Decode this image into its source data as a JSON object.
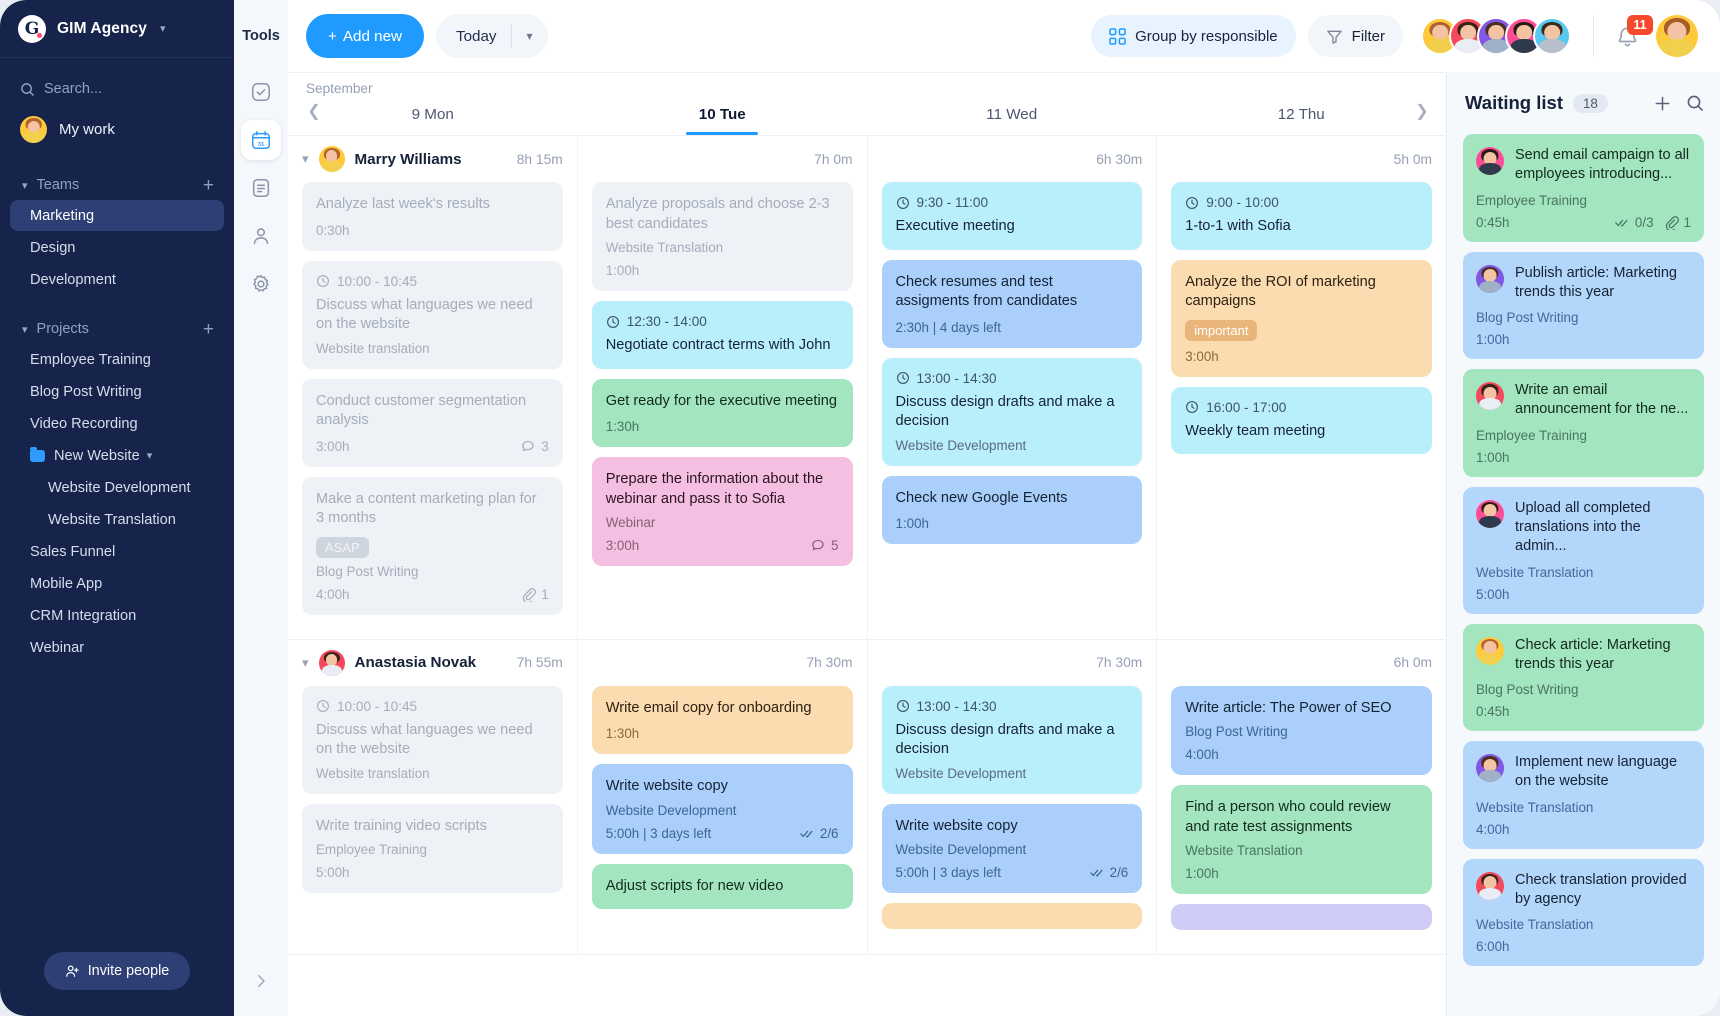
{
  "sidebar": {
    "brand": {
      "name": "GIM Agency",
      "logo_letter": "G",
      "chevron": "⌄"
    },
    "search_placeholder": "Search...",
    "my_work_label": "My work",
    "teams": {
      "title": "Teams",
      "add_label": "+",
      "items": [
        {
          "label": "Marketing",
          "active": true
        },
        {
          "label": "Design",
          "active": false
        },
        {
          "label": "Development",
          "active": false
        }
      ]
    },
    "projects": {
      "title": "Projects",
      "add_label": "+",
      "items": [
        {
          "label": "Employee Training",
          "type": "item"
        },
        {
          "label": "Blog Post Writing",
          "type": "item"
        },
        {
          "label": "Video Recording",
          "type": "item"
        },
        {
          "label": "New Website",
          "type": "folder"
        },
        {
          "label": "Website Development",
          "type": "sub"
        },
        {
          "label": "Website Translation",
          "type": "sub"
        },
        {
          "label": "Sales Funnel",
          "type": "item"
        },
        {
          "label": "Mobile App",
          "type": "item"
        },
        {
          "label": "CRM Integration",
          "type": "item"
        },
        {
          "label": "Webinar",
          "type": "item"
        }
      ]
    },
    "invite_label": "Invite people"
  },
  "rail": {
    "title": "Tools",
    "items": [
      {
        "icon": "checkbox-icon",
        "selected": false
      },
      {
        "icon": "calendar-icon",
        "selected": true
      },
      {
        "icon": "notes-icon",
        "selected": false
      },
      {
        "icon": "person-icon",
        "selected": false
      },
      {
        "icon": "gear-icon",
        "selected": false
      }
    ],
    "expand_icon": "chevron-right-icon"
  },
  "topbar": {
    "add_new_label": "Add new",
    "today_label": "Today",
    "group_by_label": "Group by responsible",
    "filter_label": "Filter",
    "notification_count": "11",
    "accent_color": "#1f9bff",
    "badge_color": "#f4492d"
  },
  "calendar": {
    "month": "September",
    "days": [
      {
        "label": "9 Mon",
        "today": false
      },
      {
        "label": "10 Tue",
        "today": true
      },
      {
        "label": "11 Wed",
        "today": false
      },
      {
        "label": "12 Thu",
        "today": false
      }
    ],
    "rows": [
      {
        "person": "Marry Williams",
        "totals": [
          "8h 15m",
          "7h 0m",
          "6h 30m",
          "5h 0m"
        ],
        "columns": [
          [
            {
              "color": "grey",
              "title": "Analyze last week's results",
              "duration": "0:30h"
            },
            {
              "color": "grey",
              "time": "10:00 - 10:45",
              "title": "Discuss what languages we need on the website",
              "project": "Website translation"
            },
            {
              "color": "grey",
              "title": "Conduct customer segmentation analysis",
              "duration": "3:00h",
              "comments": "3"
            },
            {
              "color": "grey",
              "title": "Make a content marketing plan for 3 months",
              "tag": "ASAP",
              "project": "Blog Post Writing",
              "duration": "4:00h",
              "attachments": "1"
            }
          ],
          [
            {
              "color": "grey",
              "title": "Analyze proposals and choose 2-3 best candidates",
              "project": "Website Translation",
              "duration": "1:00h"
            },
            {
              "color": "cyan",
              "time": "12:30 - 14:00",
              "title": "Negotiate contract terms with John"
            },
            {
              "color": "green",
              "title": "Get ready for the executive meeting",
              "duration": "1:30h"
            },
            {
              "color": "pink",
              "title": "Prepare the information about the webinar and pass it to Sofia",
              "project": "Webinar",
              "duration": "3:00h",
              "comments": "5"
            }
          ],
          [
            {
              "color": "cyan",
              "time": "9:30 - 11:00",
              "title": "Executive meeting"
            },
            {
              "color": "blue",
              "title": "Check resumes and test assigments from candidates",
              "meta": "2:30h | 4 days left"
            },
            {
              "color": "cyan",
              "time": "13:00 - 14:30",
              "title": "Discuss design drafts and make a decision",
              "project": "Website Development"
            },
            {
              "color": "blue",
              "title": "Check new Google Events",
              "duration": "1:00h"
            }
          ],
          [
            {
              "color": "cyan",
              "time": "9:00 - 10:00",
              "title": "1-to-1 with Sofia"
            },
            {
              "color": "orange",
              "title": "Analyze the ROI of marketing campaigns",
              "tag": "important",
              "duration": "3:00h"
            },
            {
              "color": "cyan",
              "time": "16:00 - 17:00",
              "title": "Weekly team meeting"
            }
          ]
        ]
      },
      {
        "person": "Anastasia Novak",
        "totals": [
          "7h 55m",
          "7h 30m",
          "7h 30m",
          "6h 0m"
        ],
        "columns": [
          [
            {
              "color": "grey",
              "time": "10:00 - 10:45",
              "title": "Discuss what languages we need on the website",
              "project": "Website translation"
            },
            {
              "color": "grey",
              "title": "Write training video scripts",
              "project": "Employee Training",
              "duration": "5:00h"
            }
          ],
          [
            {
              "color": "orange",
              "title": "Write email copy for onboarding",
              "duration": "1:30h"
            },
            {
              "color": "blue",
              "title": "Write website copy",
              "project": "Website Development",
              "meta": "5:00h | 3 days left",
              "checks": "2/6"
            },
            {
              "color": "green",
              "title": "Adjust scripts for new video"
            }
          ],
          [
            {
              "color": "cyan",
              "time": "13:00 - 14:30",
              "title": "Discuss design drafts and make a decision",
              "project": "Website Development"
            },
            {
              "color": "blue",
              "title": "Write website copy",
              "project": "Website Development",
              "meta": "5:00h | 3 days left",
              "checks": "2/6"
            },
            {
              "color": "orange",
              "title": ""
            }
          ],
          [
            {
              "color": "blue",
              "title": "Write article: The Power of SEO",
              "project": "Blog Post Writing",
              "duration": "4:00h"
            },
            {
              "color": "green",
              "title": "Find a person who could review and rate test assignments",
              "project": "Website Translation",
              "duration": "1:00h"
            },
            {
              "color": "purple",
              "title": ""
            }
          ]
        ]
      }
    ]
  },
  "waiting_list": {
    "title": "Waiting list",
    "count": "18",
    "add_icon": "plus-icon",
    "search_icon": "search-icon",
    "items": [
      {
        "color": "green",
        "avatar": "pink",
        "title": "Send email campaign to all employees introducing...",
        "project": "Employee Training",
        "duration": "0:45h",
        "checks": "0/3",
        "attachments": "1"
      },
      {
        "color": "blue",
        "avatar": "purple",
        "title": "Publish article: Marketing trends this year",
        "project": "Blog Post Writing",
        "duration": "1:00h"
      },
      {
        "color": "green",
        "avatar": "red",
        "title": "Write an email announcement for the ne...",
        "project": "Employee Training",
        "duration": "1:00h"
      },
      {
        "color": "blue",
        "avatar": "pink",
        "title": "Upload all completed translations into the admin...",
        "project": "Website Translation",
        "duration": "5:00h"
      },
      {
        "color": "green",
        "avatar": "yellow",
        "title": "Check article: Marketing trends this year",
        "project": "Blog Post Writing",
        "duration": "0:45h"
      },
      {
        "color": "blue",
        "avatar": "purple",
        "title": "Implement new language on the website",
        "project": "Website Translation",
        "duration": "4:00h"
      },
      {
        "color": "blue",
        "avatar": "red",
        "title": "Check translation provided by agency",
        "project": "Website Translation",
        "duration": "6:00h"
      }
    ]
  }
}
